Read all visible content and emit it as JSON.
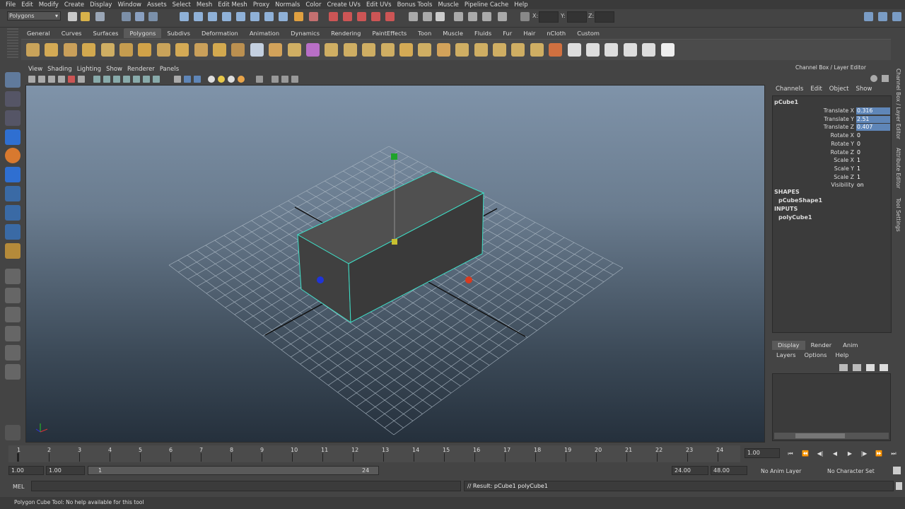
{
  "menubar": [
    "File",
    "Edit",
    "Modify",
    "Create",
    "Display",
    "Window",
    "Assets",
    "Select",
    "Mesh",
    "Edit Mesh",
    "Proxy",
    "Normals",
    "Color",
    "Create UVs",
    "Edit UVs",
    "Bonus Tools",
    "Muscle",
    "Pipeline Cache",
    "Help"
  ],
  "status": {
    "mode": "Polygons",
    "x_label": "X:",
    "y_label": "Y:",
    "z_label": "Z:"
  },
  "shelf_tabs": [
    "General",
    "Curves",
    "Surfaces",
    "Polygons",
    "Subdivs",
    "Deformation",
    "Animation",
    "Dynamics",
    "Rendering",
    "PaintEffects",
    "Toon",
    "Muscle",
    "Fluids",
    "Fur",
    "Hair",
    "nCloth",
    "Custom"
  ],
  "shelf_active": "Polygons",
  "viewport_menu": [
    "View",
    "Shading",
    "Lighting",
    "Show",
    "Renderer",
    "Panels"
  ],
  "channel_box": {
    "title": "Channel Box / Layer Editor",
    "menu": [
      "Channels",
      "Edit",
      "Object",
      "Show"
    ],
    "object": "pCube1",
    "attributes": [
      {
        "label": "Translate X",
        "value": "0.316"
      },
      {
        "label": "Translate Y",
        "value": "2.51"
      },
      {
        "label": "Translate Z",
        "value": "0.407"
      },
      {
        "label": "Rotate X",
        "value": "0"
      },
      {
        "label": "Rotate Y",
        "value": "0"
      },
      {
        "label": "Rotate Z",
        "value": "0"
      },
      {
        "label": "Scale X",
        "value": "1"
      },
      {
        "label": "Scale Y",
        "value": "1"
      },
      {
        "label": "Scale Z",
        "value": "1"
      },
      {
        "label": "Visibility",
        "value": "on"
      }
    ],
    "shapes_head": "SHAPES",
    "shape": "pCubeShape1",
    "inputs_head": "INPUTS",
    "input": "polyCube1",
    "side_tabs": [
      "Channel Box / Layer Editor",
      "Attribute Editor",
      "Tool Settings"
    ]
  },
  "layer_editor": {
    "tabs": [
      "Display",
      "Render",
      "Anim"
    ],
    "menu": [
      "Layers",
      "Options",
      "Help"
    ]
  },
  "timeline": {
    "ticks": [
      "1",
      "2",
      "3",
      "4",
      "5",
      "6",
      "7",
      "8",
      "9",
      "10",
      "11",
      "12",
      "13",
      "14",
      "15",
      "16",
      "17",
      "18",
      "19",
      "20",
      "21",
      "22",
      "23",
      "24"
    ],
    "current_frame": "1.00",
    "range_start": "1.00",
    "range_start2": "1.00",
    "range_in": "1",
    "range_out": "24",
    "end": "24.00",
    "end2": "48.00",
    "anim_layer": "No Anim Layer",
    "char_set": "No Character Set"
  },
  "command": {
    "label": "MEL",
    "result": "// Result: pCube1 polyCube1"
  },
  "help_line": "Polygon Cube Tool: No help available for this tool"
}
